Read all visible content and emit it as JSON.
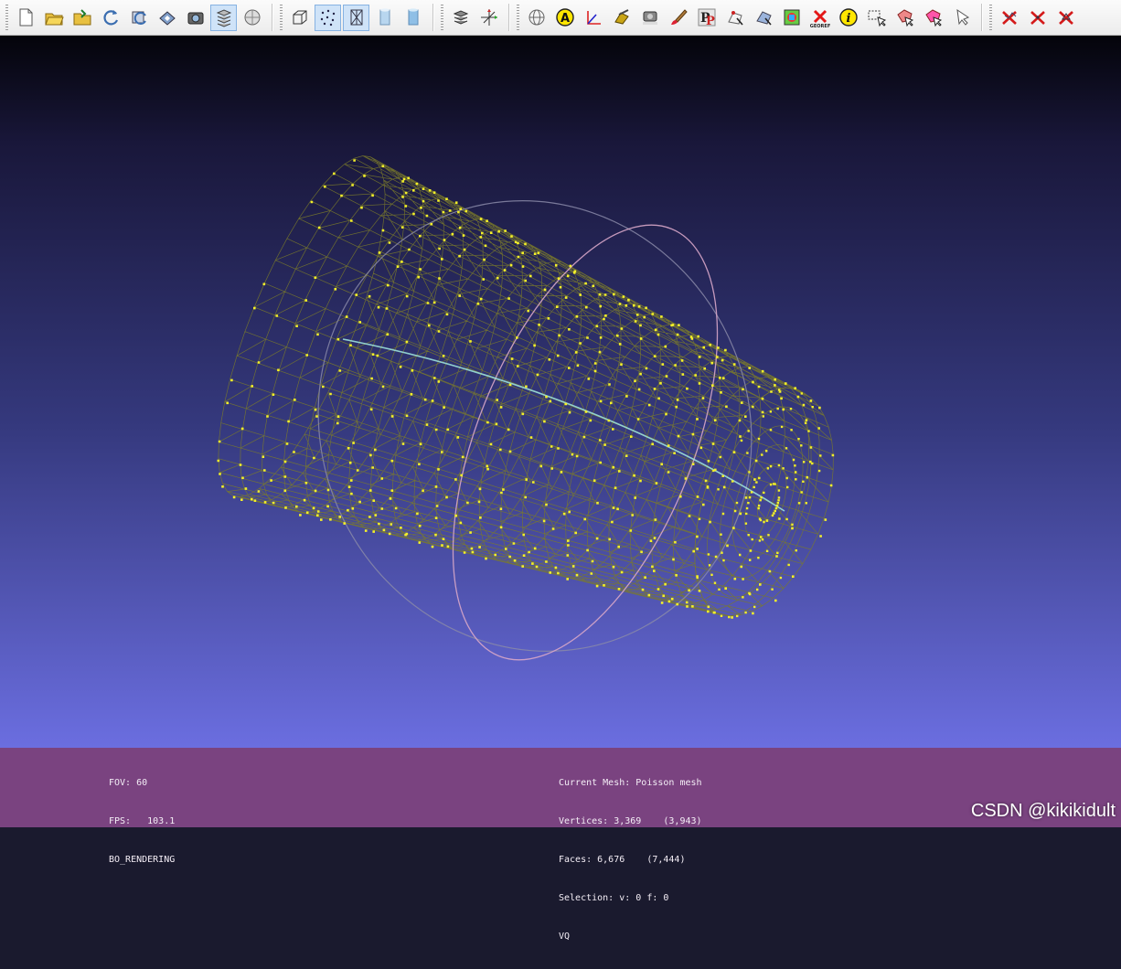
{
  "toolbar": {
    "groups": [
      [
        "new-project-icon",
        "open-project-icon",
        "import-mesh-icon",
        "reload-icon",
        "reload-all-icon",
        "export-mesh-icon",
        "snapshot-icon",
        "layers-icon",
        "decorators-icon"
      ],
      [
        "bounding-box-icon",
        "points-render-icon",
        "wireframe-icon",
        "flat-shading-icon",
        "smooth-shading-icon"
      ],
      [
        "layers-toggle-icon",
        "axes-icon"
      ],
      [
        "trackball-icon",
        "annotation-icon",
        "measure-tool-icon",
        "align-icon",
        "raster-align-icon",
        "paint-brush-icon",
        "pickpoints-icon",
        "select-vertices-icon",
        "select-faces-icon",
        "edit-texture-icon",
        "georef-icon",
        "info-icon",
        "select-rect-icon",
        "select-connected-icon",
        "select-region-icon",
        "select-pointer-icon"
      ],
      [
        "delete-selected-icon",
        "delete-vertices-icon",
        "delete-faces-icon"
      ]
    ],
    "active": [
      "layers-icon",
      "points-render-icon",
      "wireframe-icon"
    ]
  },
  "info_left": {
    "fov": "FOV: 60",
    "fps": "FPS:   103.1",
    "mode": "BO_RENDERING"
  },
  "info_right": {
    "current_mesh": "Current Mesh: Poisson mesh",
    "vertices": "Vertices: 3,369    (3,943)",
    "faces": "Faces: 6,676    (7,444)",
    "selection": "Selection: v: 0 f: 0",
    "vq": "VQ"
  },
  "watermark": "CSDN @kikikidult",
  "colors": {
    "mesh_wire": "#7a7a2a",
    "mesh_points": "#f3f02a",
    "info_bar": "#7a4380",
    "viewport_top": "#04040a",
    "viewport_bottom": "#6b6ee0"
  }
}
